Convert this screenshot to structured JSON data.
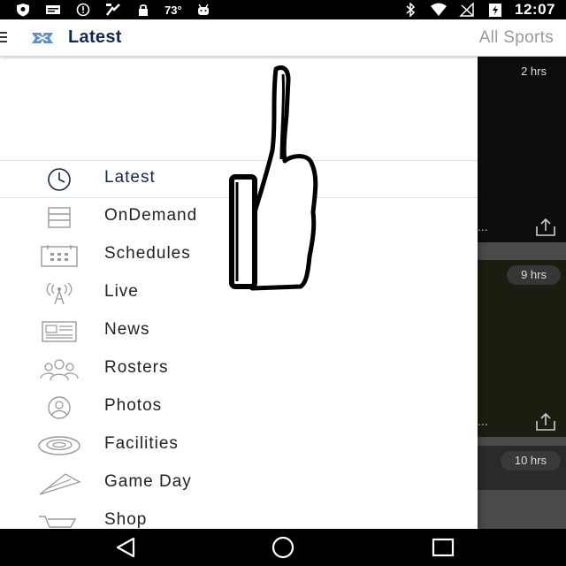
{
  "status_bar": {
    "temperature": "73°",
    "time": "12:07",
    "left_icons": [
      "shield-icon",
      "message-icon",
      "info-icon",
      "fav-icon",
      "lock-icon",
      "android-icon"
    ],
    "right_icons": [
      "bluetooth-icon",
      "wifi-icon",
      "signal-icon",
      "battery-icon"
    ]
  },
  "app_bar": {
    "title": "Latest",
    "sports_label": "All Sports",
    "accent_color": "#13294b"
  },
  "drawer": {
    "items": [
      {
        "label": "Latest",
        "icon": "clock-icon",
        "active": true
      },
      {
        "label": "OnDemand",
        "icon": "list-icon"
      },
      {
        "label": "Schedules",
        "icon": "calendar-icon"
      },
      {
        "label": "Live",
        "icon": "broadcast-icon"
      },
      {
        "label": "News",
        "icon": "newspaper-icon"
      },
      {
        "label": "Rosters",
        "icon": "group-icon"
      },
      {
        "label": "Photos",
        "icon": "person-photo-icon"
      },
      {
        "label": "Facilities",
        "icon": "stadium-icon"
      },
      {
        "label": "Game Day",
        "icon": "pennant-icon"
      },
      {
        "label": "Shop",
        "icon": "cart-icon"
      }
    ]
  },
  "background_cards": [
    {
      "time": "2 hrs",
      "dots": "..."
    },
    {
      "time": "9 hrs",
      "dots": "..."
    },
    {
      "time": "10 hrs"
    }
  ]
}
